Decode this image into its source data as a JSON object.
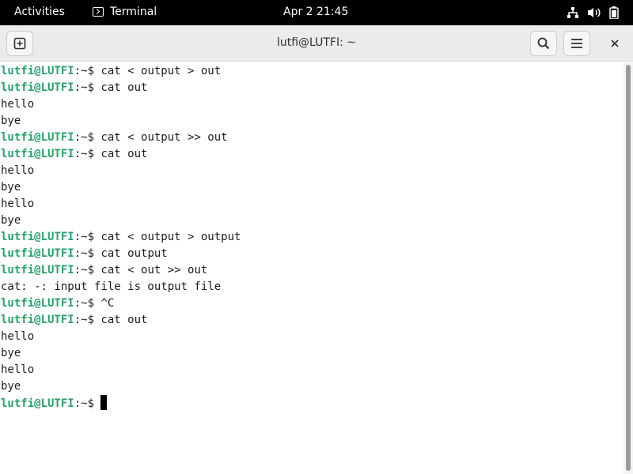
{
  "topbar": {
    "activities": "Activities",
    "app_name": "Terminal",
    "clock": "Apr 2  21:45",
    "tray_icons": [
      "network-icon",
      "volume-icon",
      "battery-icon"
    ]
  },
  "window": {
    "title": "lutfi@LUTFI: ~"
  },
  "terminal": {
    "prompt_user": "lutfi@LUTFI",
    "prompt_path": ":~$ ",
    "lines": [
      {
        "type": "prompt",
        "cmd": "cat < output > out"
      },
      {
        "type": "prompt",
        "cmd": "cat out"
      },
      {
        "type": "output",
        "text": "hello"
      },
      {
        "type": "output",
        "text": "bye"
      },
      {
        "type": "prompt",
        "cmd": "cat < output >> out"
      },
      {
        "type": "prompt",
        "cmd": "cat out"
      },
      {
        "type": "output",
        "text": "hello"
      },
      {
        "type": "output",
        "text": "bye"
      },
      {
        "type": "output",
        "text": "hello"
      },
      {
        "type": "output",
        "text": "bye"
      },
      {
        "type": "prompt",
        "cmd": "cat < output > output"
      },
      {
        "type": "prompt",
        "cmd": "cat output"
      },
      {
        "type": "prompt",
        "cmd": "cat < out >> out"
      },
      {
        "type": "output",
        "text": "cat: -: input file is output file"
      },
      {
        "type": "prompt",
        "cmd": "^C"
      },
      {
        "type": "prompt",
        "cmd": "cat out"
      },
      {
        "type": "output",
        "text": "hello"
      },
      {
        "type": "output",
        "text": "bye"
      },
      {
        "type": "output",
        "text": "hello"
      },
      {
        "type": "output",
        "text": "bye"
      },
      {
        "type": "prompt",
        "cmd": "",
        "cursor": true
      }
    ]
  },
  "colors": {
    "prompt": "#26a269",
    "topbar_bg": "#000000",
    "headerbar_bg": "#ebebeb"
  }
}
